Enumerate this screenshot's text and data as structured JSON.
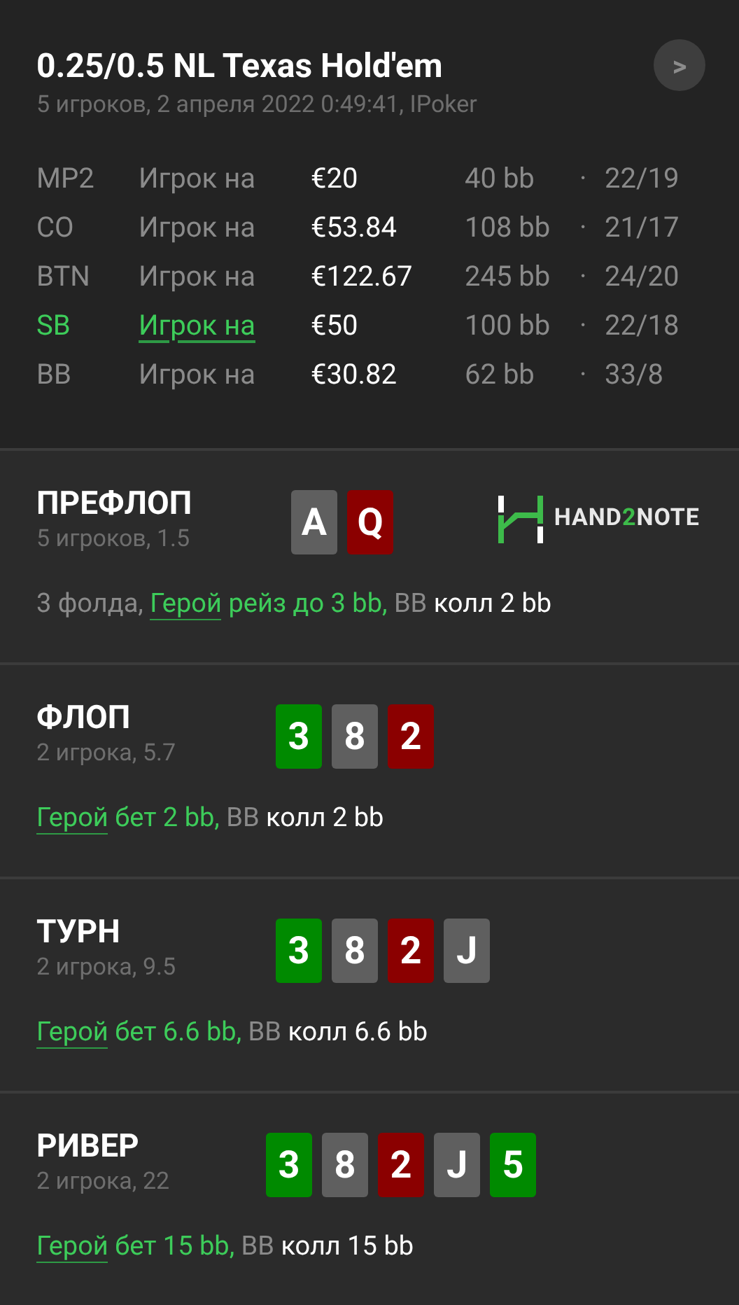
{
  "header": {
    "title": "0.25/0.5 NL Texas Hold'em",
    "subtitle": "5 игроков, 2 апреля 2022 0:49:41, IPoker",
    "next_button": ">"
  },
  "players": [
    {
      "position": "MP2",
      "name": "Игрок на",
      "stack": "€20",
      "bb": "40 bb",
      "dot": "·",
      "stats": "22/19",
      "selected": false
    },
    {
      "position": "CO",
      "name": "Игрок на",
      "stack": "€53.84",
      "bb": "108 bb",
      "dot": "·",
      "stats": "21/17",
      "selected": false
    },
    {
      "position": "BTN",
      "name": "Игрок на",
      "stack": "€122.67",
      "bb": "245 bb",
      "dot": "·",
      "stats": "24/20",
      "selected": false
    },
    {
      "position": "SB",
      "name": "Игрок на",
      "stack": "€50",
      "bb": "100 bb",
      "dot": "·",
      "stats": "22/18",
      "selected": true
    },
    {
      "position": "BB",
      "name": "Игрок на",
      "stack": "€30.82",
      "bb": "62 bb",
      "dot": "·",
      "stats": "33/8",
      "selected": false
    }
  ],
  "streets": [
    {
      "title": "ПРЕФЛОП",
      "subtitle": "5 игроков, 1.5",
      "logo": [
        "HAND",
        "2",
        "NOTE"
      ],
      "cards": [
        {
          "rank": "A",
          "color": "#5f5f5f"
        },
        {
          "rank": "Q",
          "color": "#8b0000"
        }
      ],
      "actions": [
        {
          "text": "3 фолда, ",
          "kind": "gray"
        },
        {
          "text": "Герой",
          "kind": "hero_link"
        },
        {
          "text": " рейз до 3 bb, ",
          "kind": "hero"
        },
        {
          "text": "BB ",
          "kind": "gray"
        },
        {
          "text": "колл 2 bb",
          "kind": "plain"
        }
      ]
    },
    {
      "title": "ФЛОП",
      "subtitle": "2 игрока, 5.7",
      "cards": [
        {
          "rank": "3",
          "color": "#008a00"
        },
        {
          "rank": "8",
          "color": "#5f5f5f"
        },
        {
          "rank": "2",
          "color": "#8b0000"
        }
      ],
      "actions": [
        {
          "text": "Герой",
          "kind": "hero_link"
        },
        {
          "text": " бет 2 bb, ",
          "kind": "hero"
        },
        {
          "text": "BB ",
          "kind": "gray"
        },
        {
          "text": "колл 2 bb",
          "kind": "plain"
        }
      ]
    },
    {
      "title": "ТУРН",
      "subtitle": "2 игрока, 9.5",
      "cards": [
        {
          "rank": "3",
          "color": "#008a00"
        },
        {
          "rank": "8",
          "color": "#5f5f5f"
        },
        {
          "rank": "2",
          "color": "#8b0000"
        },
        {
          "rank": "J",
          "color": "#5f5f5f"
        }
      ],
      "actions": [
        {
          "text": "Герой",
          "kind": "hero_link"
        },
        {
          "text": " бет 6.6 bb, ",
          "kind": "hero"
        },
        {
          "text": "BB ",
          "kind": "gray"
        },
        {
          "text": "колл 6.6 bb",
          "kind": "plain"
        }
      ]
    },
    {
      "title": "РИВЕР",
      "subtitle": "2 игрока, 22",
      "cards": [
        {
          "rank": "3",
          "color": "#008a00"
        },
        {
          "rank": "8",
          "color": "#5f5f5f"
        },
        {
          "rank": "2",
          "color": "#8b0000"
        },
        {
          "rank": "J",
          "color": "#5f5f5f"
        },
        {
          "rank": "5",
          "color": "#008a00"
        }
      ],
      "actions": [
        {
          "text": "Герой",
          "kind": "hero_link"
        },
        {
          "text": " бет 15 bb, ",
          "kind": "hero"
        },
        {
          "text": "BB ",
          "kind": "gray"
        },
        {
          "text": "колл 15 bb",
          "kind": "plain"
        }
      ]
    }
  ]
}
